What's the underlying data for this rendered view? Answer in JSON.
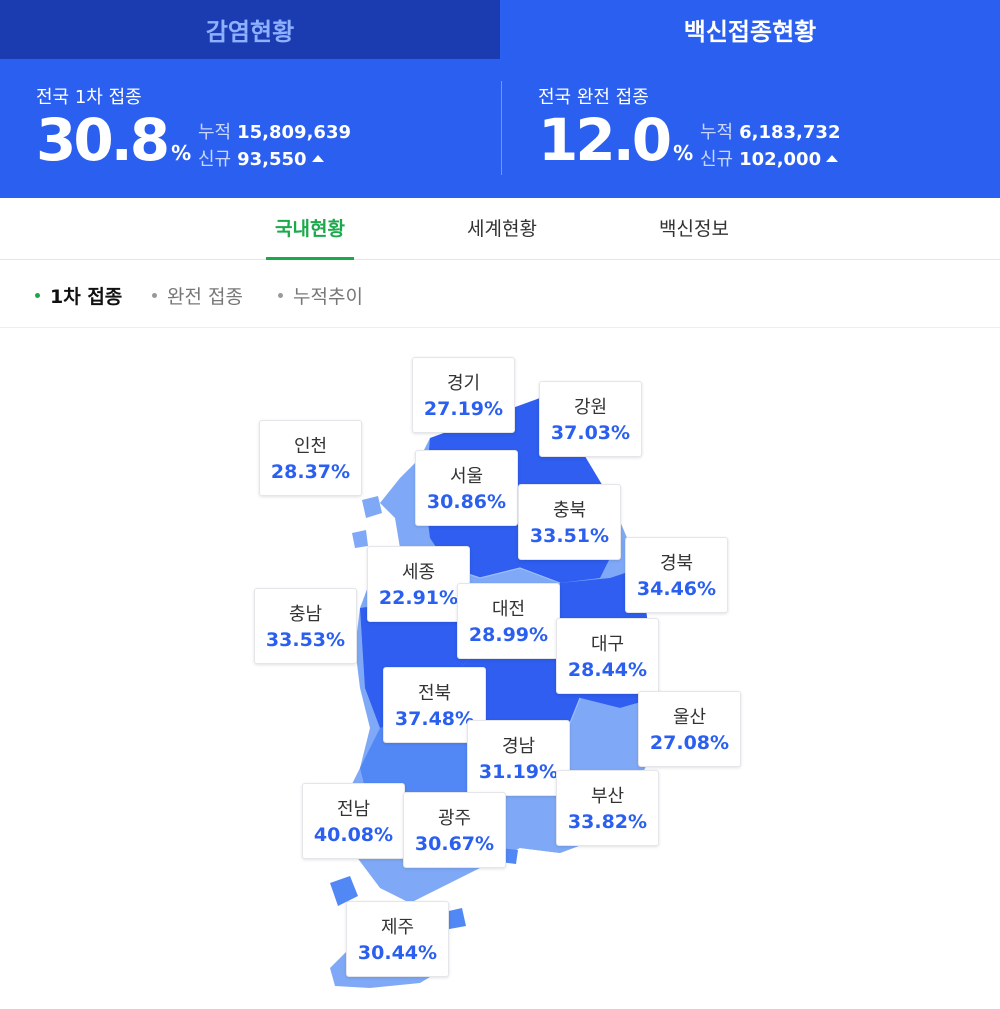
{
  "top_tabs": [
    {
      "label": "감염현황"
    },
    {
      "label": "백신접종현황"
    }
  ],
  "summary": {
    "first": {
      "title": "전국 1차 접종",
      "percent": "30.8",
      "unit": "%",
      "cumulative_label": "누적",
      "cumulative": "15,809,639",
      "new_label": "신규",
      "new": "93,550",
      "trend_icon": "triangle-up-icon"
    },
    "full": {
      "title": "전국 완전 접종",
      "percent": "12.0",
      "unit": "%",
      "cumulative_label": "누적",
      "cumulative": "6,183,732",
      "new_label": "신규",
      "new": "102,000",
      "trend_icon": "triangle-up-icon"
    }
  },
  "sub_tabs": [
    {
      "label": "국내현황"
    },
    {
      "label": "세계현황"
    },
    {
      "label": "백신정보"
    }
  ],
  "filters": [
    {
      "label": "1차 접종"
    },
    {
      "label": "완전 접종"
    },
    {
      "label": "누적추이"
    }
  ],
  "regions": [
    {
      "name": "경기",
      "rate": "27.19%"
    },
    {
      "name": "강원",
      "rate": "37.03%"
    },
    {
      "name": "인천",
      "rate": "28.37%"
    },
    {
      "name": "서울",
      "rate": "30.86%"
    },
    {
      "name": "충북",
      "rate": "33.51%"
    },
    {
      "name": "경북",
      "rate": "34.46%"
    },
    {
      "name": "세종",
      "rate": "22.91%"
    },
    {
      "name": "대전",
      "rate": "28.99%"
    },
    {
      "name": "충남",
      "rate": "33.53%"
    },
    {
      "name": "대구",
      "rate": "28.44%"
    },
    {
      "name": "전북",
      "rate": "37.48%"
    },
    {
      "name": "울산",
      "rate": "27.08%"
    },
    {
      "name": "경남",
      "rate": "31.19%"
    },
    {
      "name": "전남",
      "rate": "40.08%"
    },
    {
      "name": "부산",
      "rate": "33.82%"
    },
    {
      "name": "광주",
      "rate": "30.67%"
    },
    {
      "name": "제주",
      "rate": "30.44%"
    }
  ],
  "colors": {
    "primary": "#2a5ff0",
    "tab_inactive_bg": "#1a3cb0",
    "active_green": "#1ba94c",
    "map_dark": "#2f5ef0",
    "map_mid": "#5288f5",
    "map_light": "#7fa9f7"
  }
}
